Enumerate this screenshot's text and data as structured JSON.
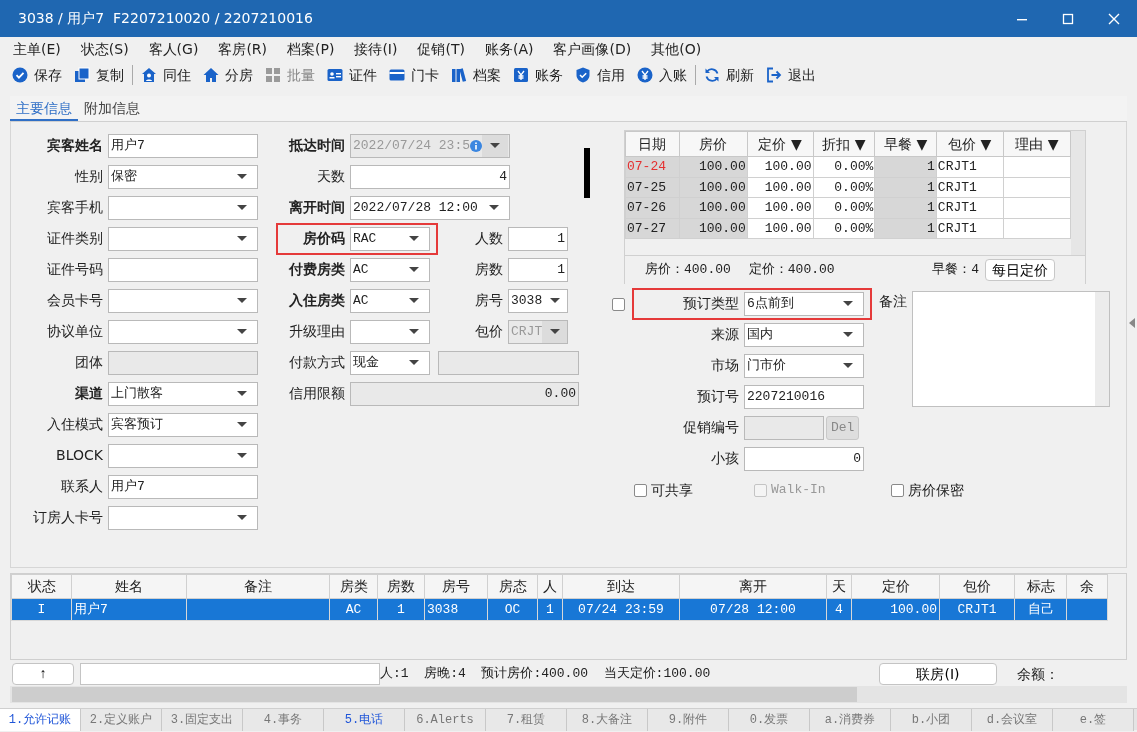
{
  "window": {
    "title": "3038 / 用户7  F2207210020 / 2207210016"
  },
  "menu": [
    {
      "label": "主单(E)"
    },
    {
      "label": "状态(S)"
    },
    {
      "label": "客人(G)"
    },
    {
      "label": "客房(R)"
    },
    {
      "label": "档案(P)"
    },
    {
      "label": "接待(I)"
    },
    {
      "label": "促销(T)"
    },
    {
      "label": "账务(A)"
    },
    {
      "label": "客户画像(D)"
    },
    {
      "label": "其他(O)"
    }
  ],
  "toolbar": [
    {
      "label": "保存",
      "separator_before": false,
      "disabled": false
    },
    {
      "label": "复制",
      "separator_before": false,
      "disabled": false
    },
    {
      "label": "同住",
      "separator_before": true,
      "disabled": false
    },
    {
      "label": "分房",
      "separator_before": false,
      "disabled": false
    },
    {
      "label": "批量",
      "separator_before": false,
      "disabled": true
    },
    {
      "label": "证件",
      "separator_before": false,
      "disabled": false
    },
    {
      "label": "门卡",
      "separator_before": false,
      "disabled": false
    },
    {
      "label": "档案",
      "separator_before": false,
      "disabled": false
    },
    {
      "label": "账务",
      "separator_before": false,
      "disabled": false
    },
    {
      "label": "信用",
      "separator_before": false,
      "disabled": false
    },
    {
      "label": "入账",
      "separator_before": false,
      "disabled": false
    },
    {
      "label": "刷新",
      "separator_before": true,
      "disabled": false
    },
    {
      "label": "退出",
      "separator_before": false,
      "disabled": false
    }
  ],
  "tabs": [
    {
      "label": "主要信息",
      "selected": true
    },
    {
      "label": "附加信息",
      "selected": false
    }
  ],
  "left_fields": [
    {
      "label": "宾客姓名",
      "bold": true,
      "kind": "text",
      "value": "用户7"
    },
    {
      "label": "性别",
      "bold": false,
      "kind": "select",
      "value": "保密"
    },
    {
      "label": "宾客手机",
      "bold": false,
      "kind": "select"
    },
    {
      "label": "证件类别",
      "bold": false,
      "kind": "select"
    },
    {
      "label": "证件号码",
      "bold": false,
      "kind": "text"
    },
    {
      "label": "会员卡号",
      "bold": false,
      "kind": "select"
    },
    {
      "label": "协议单位",
      "bold": false,
      "kind": "select"
    },
    {
      "label": "团体",
      "bold": false,
      "kind": "readonly"
    },
    {
      "label": "渠道",
      "bold": true,
      "kind": "select",
      "value": "上门散客"
    },
    {
      "label": "入住模式",
      "bold": false,
      "kind": "select",
      "value": "宾客预订"
    },
    {
      "label": "BLOCK",
      "bold": false,
      "kind": "select"
    },
    {
      "label": "联系人",
      "bold": false,
      "kind": "text",
      "value": "用户7"
    },
    {
      "label": "订房人卡号",
      "bold": false,
      "kind": "select"
    }
  ],
  "middle_rows": [
    [
      {
        "label": "抵达时间",
        "bold": true,
        "kind": "date-disabled",
        "value": "2022/07/24 23:5",
        "annotated": false
      }
    ],
    [
      {
        "label": "天数",
        "bold": false,
        "kind": "number",
        "value": "4",
        "annotated": false
      }
    ],
    [
      {
        "label": "离开时间",
        "bold": true,
        "kind": "date",
        "value": "2022/07/28 12:00",
        "annotated": false
      }
    ],
    [
      {
        "label": "房价码",
        "bold": true,
        "kind": "select",
        "value": "RAC",
        "annotated": true
      },
      {
        "label": "人数",
        "bold": false,
        "kind": "number",
        "value": "1",
        "annotated": false
      }
    ],
    [
      {
        "label": "付费房类",
        "bold": true,
        "kind": "select",
        "value": "AC",
        "annotated": false
      },
      {
        "label": "房数",
        "bold": false,
        "kind": "number",
        "value": "1",
        "annotated": false
      }
    ],
    [
      {
        "label": "入住房类",
        "bold": true,
        "kind": "select",
        "value": "AC",
        "annotated": false
      },
      {
        "label": "房号",
        "bold": false,
        "kind": "select",
        "value": "3038",
        "annotated": false
      }
    ],
    [
      {
        "label": "升级理由",
        "bold": false,
        "kind": "select",
        "annotated": false
      },
      {
        "label": "包价",
        "bold": false,
        "kind": "select-disabled",
        "value": "CRJT",
        "annotated": false
      }
    ],
    [
      {
        "label": "付款方式",
        "bold": false,
        "kind": "select",
        "value": "现金",
        "annotated": false
      },
      {
        "kind": "readonly",
        "annotated": false
      }
    ],
    [
      {
        "label": "信用限额",
        "bold": false,
        "kind": "amount",
        "value": "0.00",
        "annotated": false
      }
    ]
  ],
  "rate_table": {
    "columns": [
      "日期",
      "房价",
      "定价 ▼",
      "折扣 ▼",
      "早餐 ▼",
      "包价 ▼",
      "理由 ▼"
    ],
    "rows": [
      {
        "highlighted": true,
        "cells": [
          "07-24",
          "100.00",
          "100.00",
          "0.00%",
          "1",
          "CRJT1"
        ]
      },
      {
        "highlighted": false,
        "cells": [
          "07-25",
          "100.00",
          "100.00",
          "0.00%",
          "1",
          "CRJT1"
        ]
      },
      {
        "highlighted": false,
        "cells": [
          "07-26",
          "100.00",
          "100.00",
          "0.00%",
          "1",
          "CRJT1"
        ]
      },
      {
        "highlighted": false,
        "cells": [
          "07-27",
          "100.00",
          "100.00",
          "0.00%",
          "1",
          "CRJT1"
        ]
      }
    ]
  },
  "rate_summary": {
    "room_rate": "房价：400.00",
    "fixed_rate": "定价：400.00",
    "breakfast": "早餐：4",
    "button": "每日定价"
  },
  "lead_checkbox": {
    "checked": false
  },
  "booking_fields": [
    {
      "label": "预订类型",
      "kind": "select",
      "value": "6点前到",
      "annotated": true
    },
    {
      "label": "来源",
      "kind": "select",
      "value": "国内",
      "annotated": false
    },
    {
      "label": "市场",
      "kind": "select",
      "value": "门市价",
      "annotated": false
    },
    {
      "label": "预订号",
      "kind": "text",
      "value": "2207210016",
      "annotated": false
    },
    {
      "label": "促销编号",
      "kind": "promo",
      "button": "Del",
      "annotated": false
    },
    {
      "label": "小孩",
      "kind": "number",
      "value": "0",
      "annotated": false
    }
  ],
  "remark": {
    "label": "备注"
  },
  "checkboxes": [
    {
      "label": "可共享",
      "checked": false,
      "disabled": false
    },
    {
      "label": "Walk-In",
      "checked": false,
      "disabled": true
    },
    {
      "label": "房价保密",
      "checked": false,
      "disabled": false
    }
  ],
  "guest_table": {
    "columns": [
      "状态",
      "姓名",
      "备注",
      "房类",
      "房数",
      "房号",
      "房态",
      "人",
      "到达",
      "离开",
      "天",
      "定价",
      "包价",
      "标志",
      "余"
    ],
    "rows": [
      {
        "selected": true,
        "cells": [
          "I",
          "用户7",
          "",
          "AC",
          "1",
          "3038",
          "OC",
          "1",
          "07/24 23:59",
          "07/28 12:00",
          "4",
          "100.00",
          "CRJT1",
          "自己",
          ""
        ]
      }
    ]
  },
  "footer": {
    "up_button": "↑",
    "summary": "人:1  房晚:4  预计房价:400.00  当天定价:100.00",
    "link_button": "联房(I)",
    "balance": "余额："
  },
  "bottom_tabs": [
    {
      "label": "1.允许记账",
      "selected": true,
      "highlighted": true
    },
    {
      "label": "2.定义账户",
      "selected": false,
      "highlighted": false
    },
    {
      "label": "3.固定支出",
      "selected": false,
      "highlighted": false
    },
    {
      "label": "4.事务",
      "selected": false,
      "highlighted": false
    },
    {
      "label": "5.电话",
      "selected": false,
      "highlighted": true
    },
    {
      "label": "6.Alerts",
      "selected": false,
      "highlighted": false
    },
    {
      "label": "7.租赁",
      "selected": false,
      "highlighted": false
    },
    {
      "label": "8.大备注",
      "selected": false,
      "highlighted": false
    },
    {
      "label": "9.附件",
      "selected": false,
      "highlighted": false
    },
    {
      "label": "0.发票",
      "selected": false,
      "highlighted": false
    },
    {
      "label": "a.消费券",
      "selected": false,
      "highlighted": false
    },
    {
      "label": "b.小团",
      "selected": false,
      "highlighted": false
    },
    {
      "label": "d.会议室",
      "selected": false,
      "highlighted": false
    },
    {
      "label": "e.签",
      "selected": false,
      "highlighted": false
    }
  ]
}
